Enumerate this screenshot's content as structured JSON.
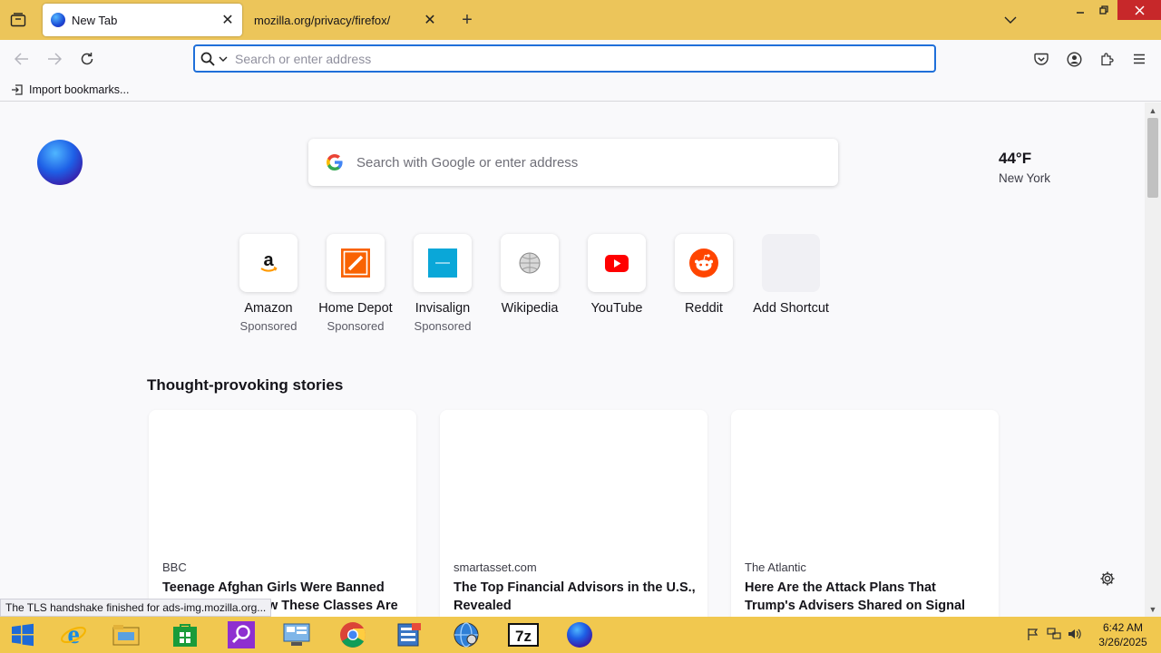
{
  "tabs": [
    {
      "label": "New Tab",
      "active": true
    },
    {
      "label": "mozilla.org/privacy/firefox/",
      "active": false
    }
  ],
  "urlbar": {
    "placeholder": "Search or enter address",
    "value": ""
  },
  "bookmarks": {
    "import_label": "Import bookmarks..."
  },
  "newtab": {
    "search_placeholder": "Search with Google or enter address",
    "weather": {
      "temp": "44°F",
      "city": "New York"
    },
    "shortcuts": [
      {
        "title": "Amazon",
        "sub": "Sponsored",
        "icon": "amazon-icon"
      },
      {
        "title": "Home Depot",
        "sub": "Sponsored",
        "icon": "home-depot-icon"
      },
      {
        "title": "Invisalign",
        "sub": "Sponsored",
        "icon": "invisalign-icon"
      },
      {
        "title": "Wikipedia",
        "sub": "",
        "icon": "wikipedia-icon"
      },
      {
        "title": "YouTube",
        "sub": "",
        "icon": "youtube-icon"
      },
      {
        "title": "Reddit",
        "sub": "",
        "icon": "reddit-icon"
      },
      {
        "title": "Add Shortcut",
        "sub": "",
        "icon": "add-shortcut-icon"
      }
    ],
    "section_title": "Thought-provoking stories",
    "stories": [
      {
        "source": "BBC",
        "headline": "Teenage Afghan Girls Were Banned From School. Now These Classes Are"
      },
      {
        "source": "smartasset.com",
        "headline": "The Top Financial Advisors in the U.S., Revealed"
      },
      {
        "source": "The Atlantic",
        "headline": "Here Are the Attack Plans That Trump's Advisers Shared on Signal"
      }
    ]
  },
  "status_tip": "The TLS handshake finished for ads-img.mozilla.org...",
  "taskbar": {
    "apps": [
      "internet-explorer-icon",
      "file-explorer-icon",
      "store-icon",
      "search-app-icon",
      "control-panel-icon",
      "chrome-icon",
      "registry-editor-icon",
      "network-globe-icon",
      "7zip-icon",
      "firefox-icon"
    ],
    "time": "6:42 AM",
    "date": "3/26/2025"
  },
  "colors": {
    "tabbar": "#ecc55a",
    "taskbar": "#f1c84f",
    "accent": "#1f6fd9",
    "close": "#c7282a"
  }
}
